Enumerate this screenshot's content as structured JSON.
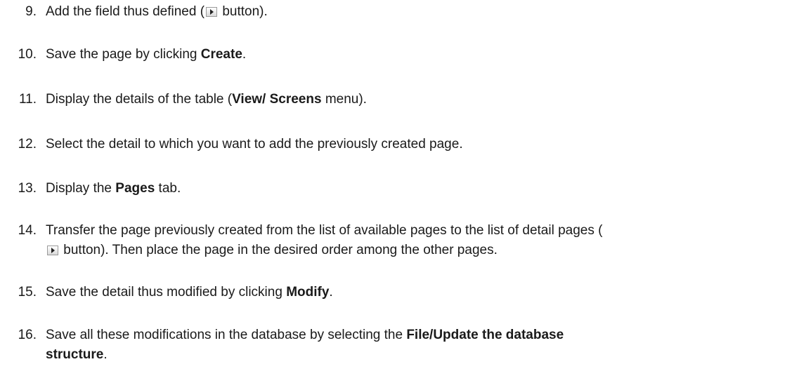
{
  "steps": [
    {
      "number": "9.",
      "parts": [
        "Add the field thus defined (",
        "{icon}",
        " button)."
      ]
    },
    {
      "number": "10.",
      "parts": [
        "Save the page by clicking ",
        "**Create",
        "."
      ]
    },
    {
      "number": "11.",
      "parts": [
        "Display the details of the table (",
        "**View/ Screens",
        " menu)."
      ]
    },
    {
      "number": "12.",
      "parts": [
        "Select the detail to which you want to add the previously created page."
      ]
    },
    {
      "number": "13.",
      "parts": [
        "Display the ",
        "**Pages",
        " tab."
      ]
    },
    {
      "number": "14.",
      "lines": [
        [
          "Transfer the page previously created from the list of available pages to the list of detail pages ("
        ],
        [
          "{icon}",
          " button). Then place the page in the desired order among the other pages."
        ]
      ]
    },
    {
      "number": "15.",
      "parts": [
        "Save the detail thus modified by clicking ",
        "**Modify",
        "."
      ]
    },
    {
      "number": "16.",
      "lines": [
        [
          "Save all these modifications in the database by selecting the ",
          "**File/Update the database"
        ],
        [
          "**structure",
          "."
        ]
      ]
    }
  ],
  "icons": {
    "transfer_button": "arrow-right-button-icon"
  }
}
